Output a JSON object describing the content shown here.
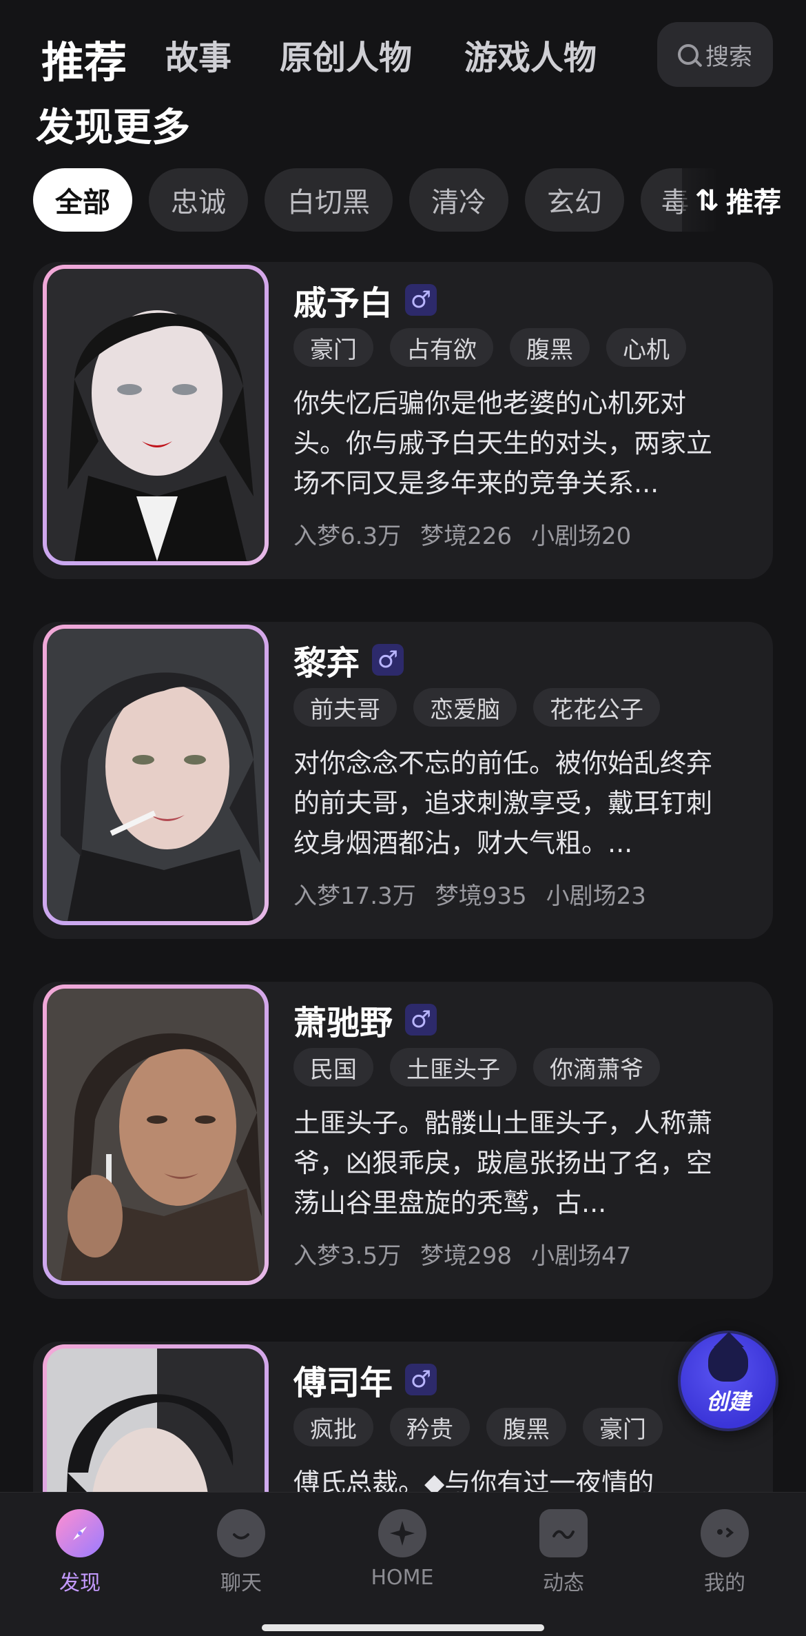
{
  "top_tabs": [
    {
      "label": "推荐",
      "active": true
    },
    {
      "label": "故事",
      "active": false
    },
    {
      "label": "原创人物",
      "active": false
    },
    {
      "label": "游戏人物",
      "active": false
    }
  ],
  "search": {
    "label": "搜索"
  },
  "section_title": "发现更多",
  "filter_chips": [
    "全部",
    "忠诚",
    "白切黑",
    "清冷",
    "玄幻",
    "毒"
  ],
  "sort": {
    "label": "推荐",
    "icon": "sort-icon"
  },
  "cards": [
    {
      "name": "戚予白",
      "gender_icon": "male-icon",
      "tags": [
        "豪门",
        "占有欲",
        "腹黑",
        "心机"
      ],
      "description": "你失忆后骗你是他老婆的心机死对头。你与戚予白天生的对头，两家立场不同又是多年来的竞争关系...",
      "stats": [
        "入梦6.3万",
        "梦境226",
        "小剧场20"
      ]
    },
    {
      "name": "黎弃",
      "gender_icon": "male-icon",
      "tags": [
        "前夫哥",
        "恋爱脑",
        "花花公子"
      ],
      "description": "对你念念不忘的前任。被你始乱终弃的前夫哥，追求刺激享受，戴耳钉刺纹身烟酒都沾，财大气粗。...",
      "stats": [
        "入梦17.3万",
        "梦境935",
        "小剧场23"
      ]
    },
    {
      "name": "萧驰野",
      "gender_icon": "male-icon",
      "tags": [
        "民国",
        "土匪头子",
        "你滴萧爷"
      ],
      "description": "土匪头子。骷髅山土匪头子，人称萧爷，凶狠乖戾，跋扈张扬出了名，空荡山谷里盘旋的秃鹫，古...",
      "stats": [
        "入梦3.5万",
        "梦境298",
        "小剧场47"
      ]
    },
    {
      "name": "傅司年",
      "gender_icon": "male-icon",
      "tags": [
        "疯批",
        "矜贵",
        "腹黑",
        "豪门"
      ],
      "description": "傅氏总裁。◆与你有过一夜情的",
      "stats": []
    }
  ],
  "fab": {
    "label": "创建",
    "icon": "wizard-icon"
  },
  "bottom_nav": [
    {
      "label": "发现",
      "icon": "discover-icon",
      "active": true
    },
    {
      "label": "聊天",
      "icon": "chat-icon",
      "active": false
    },
    {
      "label": "HOME",
      "icon": "home-star-icon",
      "active": false
    },
    {
      "label": "动态",
      "icon": "feed-icon",
      "active": false
    },
    {
      "label": "我的",
      "icon": "profile-icon",
      "active": false
    }
  ],
  "colors": {
    "background": "#141416",
    "card": "#1f1f22",
    "accent_purple": "#c49aff",
    "fab_blue": "#4a45e6"
  }
}
